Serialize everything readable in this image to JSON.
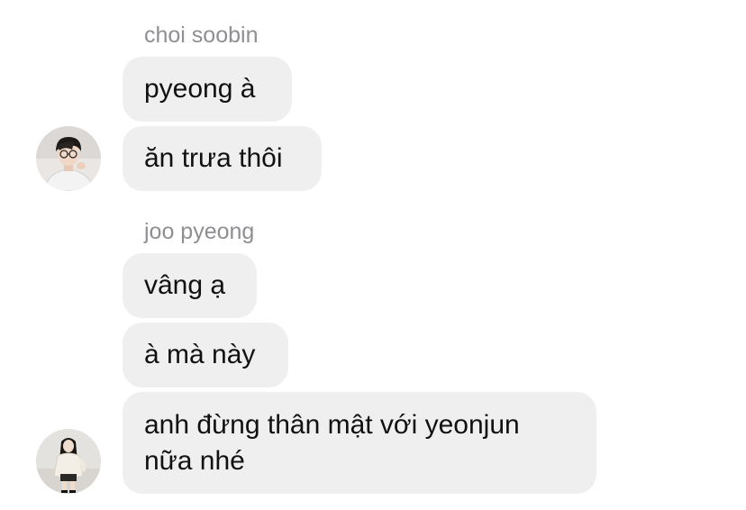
{
  "messages_group_1": {
    "sender": "choi soobin",
    "bubble_1": "pyeong à",
    "bubble_2": "ăn trưa thôi"
  },
  "messages_group_2": {
    "sender": "joo pyeong",
    "bubble_1": "vâng ạ",
    "bubble_2": "à mà này",
    "bubble_3_line_1": "anh đừng thân mật với yeonjun",
    "bubble_3_line_2": "nữa nhé"
  },
  "colors": {
    "bubble": "#efefef",
    "sender_name": "#8e8e93",
    "text": "#111111"
  },
  "icons": [
    "avatar-soobin-icon",
    "avatar-pyeong-icon"
  ]
}
